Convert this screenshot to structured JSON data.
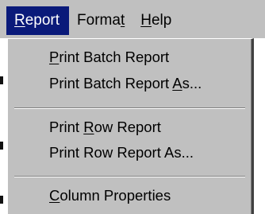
{
  "menubar": {
    "items": [
      {
        "pre": "",
        "key": "R",
        "post": "eport"
      },
      {
        "pre": "Forma",
        "key": "t",
        "post": ""
      },
      {
        "pre": "",
        "key": "H",
        "post": "elp"
      }
    ]
  },
  "menu": {
    "group1": [
      {
        "pre": "",
        "key": "P",
        "post": "rint Batch Report"
      },
      {
        "pre": "Print Batch Report ",
        "key": "A",
        "post": "s..."
      }
    ],
    "group2": [
      {
        "pre": "Print ",
        "key": "R",
        "post": "ow Report"
      },
      {
        "pre": "Print Row Report As...",
        "key": "",
        "post": ""
      }
    ],
    "group3": [
      {
        "pre": "",
        "key": "C",
        "post": "olumn Properties"
      }
    ]
  },
  "colors": {
    "menu_bg": "#c0c0c0",
    "highlight": "#0a1a7a"
  }
}
